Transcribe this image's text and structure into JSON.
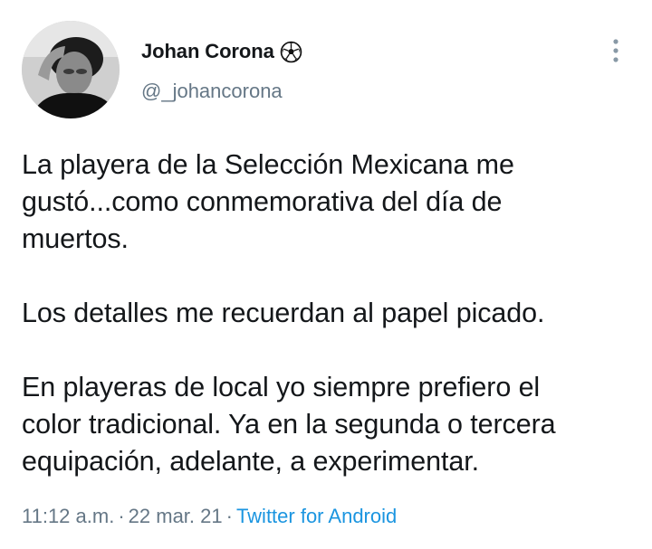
{
  "author": {
    "display_name": "Johan Corona",
    "name_emoji_icon": "soccer-ball-icon",
    "handle": "@_johancorona",
    "avatar_icon": "profile-photo"
  },
  "tweet": {
    "paragraphs": [
      {
        "lines": [
          "La playera de la Selección Mexicana me",
          "gustó...como conmemorativa del día de",
          "muertos."
        ]
      },
      {
        "lines": [
          "Los detalles me recuerdan al papel picado."
        ]
      },
      {
        "lines": [
          "En playeras de local yo siempre prefiero el",
          "color tradicional. Ya en la segunda o tercera",
          "equipación, adelante, a experimentar."
        ]
      }
    ]
  },
  "meta": {
    "time": "11:12 a.m.",
    "separator": "·",
    "date": "22 mar. 21",
    "source": "Twitter for Android"
  },
  "menu": {
    "icon": "more-vertical-icon"
  },
  "colors": {
    "text": "#14171a",
    "secondary": "#657786",
    "link": "#1b95e0",
    "background": "#ffffff"
  }
}
